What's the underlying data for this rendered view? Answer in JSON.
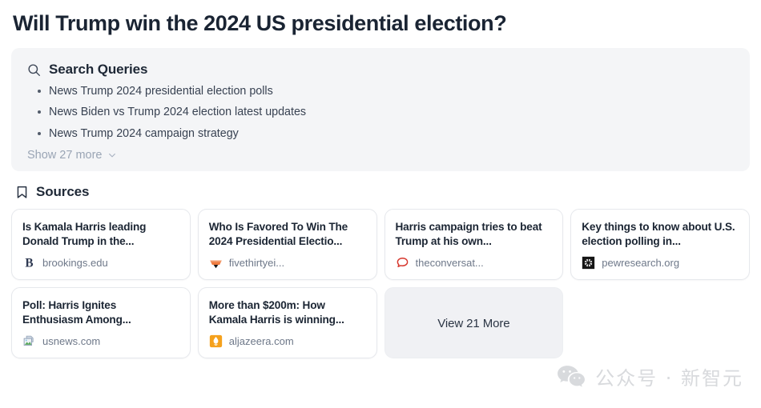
{
  "page": {
    "title": "Will Trump win the 2024 US presidential election?"
  },
  "queries": {
    "icon": "search-icon",
    "heading": "Search Queries",
    "items": [
      "News Trump 2024 presidential election polls",
      "News Biden vs Trump 2024 election latest updates",
      "News Trump 2024 campaign strategy"
    ],
    "show_more_label": "Show 27 more",
    "show_more_icon": "chevron-down-icon"
  },
  "sources": {
    "icon": "bookmark-icon",
    "heading": "Sources",
    "cards": [
      {
        "title": "Is Kamala Harris leading Donald Trump in the...",
        "domain": "brookings.edu",
        "favicon": "brookings-b-icon",
        "favicon_color": "#2f3a52"
      },
      {
        "title": "Who Is Favored To Win The 2024 Presidential Electio...",
        "domain": "fivethirtyei...",
        "favicon": "fivethirtyeight-icon",
        "favicon_color": "#ed713a"
      },
      {
        "title": "Harris campaign tries to beat Trump at his own...",
        "domain": "theconversat...",
        "favicon": "speech-bubble-icon",
        "favicon_color": "#d6352b"
      },
      {
        "title": "Key things to know about U.S. election polling in...",
        "domain": "pewresearch.org",
        "favicon": "pew-research-burst-icon",
        "favicon_color": "#1b1b1b"
      },
      {
        "title": "Poll: Harris Ignites Enthusiasm Among...",
        "domain": "usnews.com",
        "favicon": "broken-image-icon",
        "favicon_color": "#7f9fc4"
      },
      {
        "title": "More than $200m: How Kamala Harris is winning...",
        "domain": "aljazeera.com",
        "favicon": "aljazeera-flame-icon",
        "favicon_color": "#f5a11d"
      }
    ],
    "view_more_label": "View 21 More"
  },
  "watermark": {
    "icon": "wechat-icon",
    "text": "公众号 · 新智元"
  }
}
